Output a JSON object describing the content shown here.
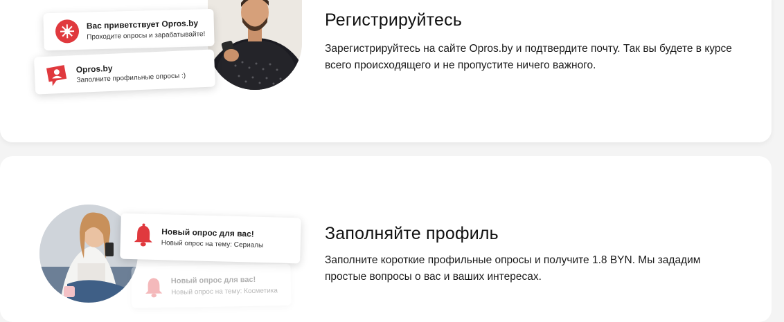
{
  "step1": {
    "title": "Регистрируйтесь",
    "text": "Зарегистрируйтесь на сайте Opros.by и подтвердите почту. Так вы будете в курсе всего происходящего и не пропустите ничего важного.",
    "notif_welcome": {
      "title": "Вас приветствует Opros.by",
      "sub": "Проходите опросы и зарабатывайте!"
    },
    "notif_profile": {
      "title": "Opros.by",
      "sub": "Заполните профильные опросы :)"
    }
  },
  "step2": {
    "title": "Заполняйте профиль",
    "text": "Заполните короткие профильные опросы и получите 1.8 BYN. Мы зададим простые вопросы о вас и ваших интересах.",
    "notif_new": {
      "title": "Новый опрос для вас!",
      "sub": "Новый опрос на тему: Сериалы"
    },
    "notif_faded": {
      "title": "Новый опрос для вас!",
      "sub": "Новый опрос на тему: Косметика"
    }
  },
  "colors": {
    "accent": "#e0393e",
    "card": "#ffffff",
    "background": "#f4f4f4"
  },
  "icons": [
    "flower-logo-icon",
    "profile-chat-icon",
    "bell-icon"
  ]
}
